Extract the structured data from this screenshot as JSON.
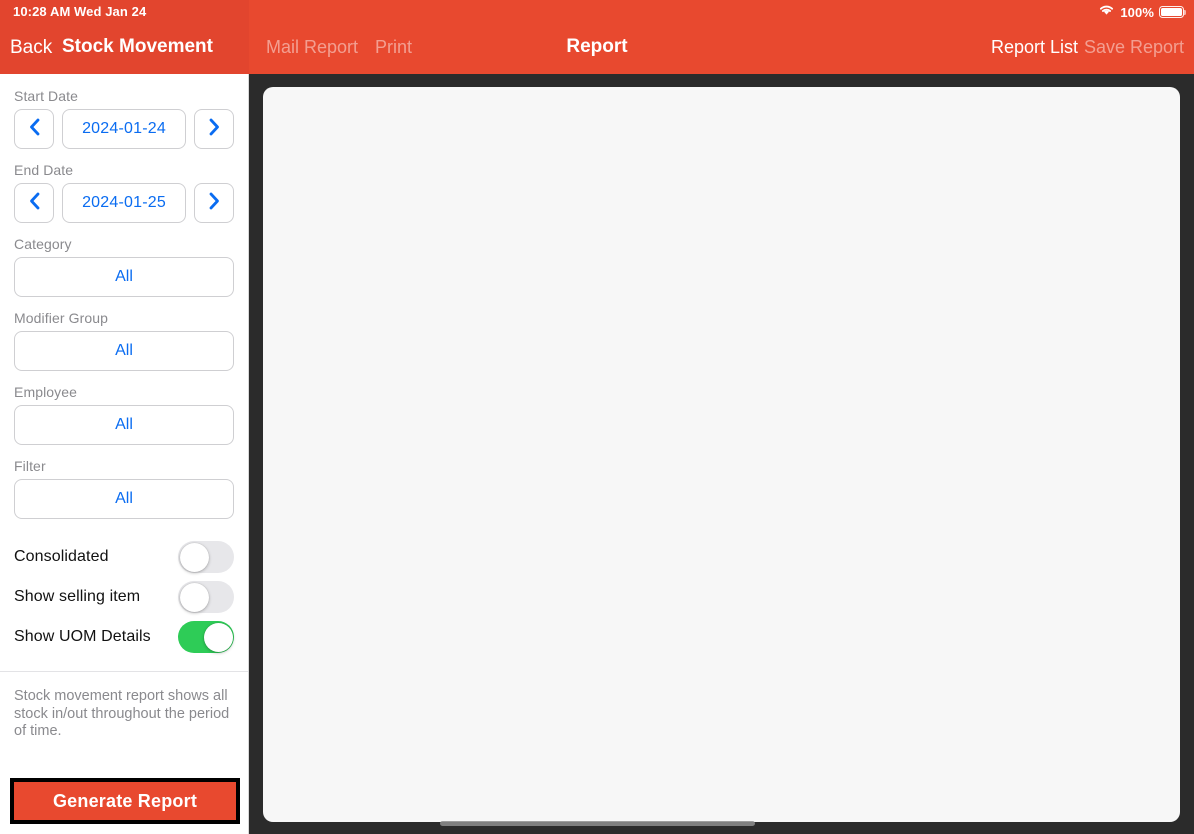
{
  "statusbar": {
    "time": "10:28 AM",
    "date": "Wed Jan 24",
    "battery_percent": "100%",
    "wifi_icon": "wifi-icon",
    "battery_icon": "battery-full-icon"
  },
  "navbar": {
    "back_label": "Back",
    "screen_title": "Stock Movement",
    "mail_report_label": "Mail Report",
    "print_label": "Print",
    "center_title": "Report",
    "report_list_label": "Report List",
    "save_report_label": "Save Report"
  },
  "sidebar": {
    "start_date": {
      "label": "Start Date",
      "value": "2024-01-24",
      "prev_icon": "chevron-left-icon",
      "next_icon": "chevron-right-icon"
    },
    "end_date": {
      "label": "End Date",
      "value": "2024-01-25",
      "prev_icon": "chevron-left-icon",
      "next_icon": "chevron-right-icon"
    },
    "category": {
      "label": "Category",
      "value": "All"
    },
    "modifier_group": {
      "label": "Modifier Group",
      "value": "All"
    },
    "employee": {
      "label": "Employee",
      "value": "All"
    },
    "filter": {
      "label": "Filter",
      "value": "All"
    },
    "toggles": [
      {
        "label": "Consolidated",
        "on": false
      },
      {
        "label": "Show selling item",
        "on": false
      },
      {
        "label": "Show UOM Details",
        "on": true
      }
    ],
    "help_text": "Stock movement report shows all stock in/out throughout the period of time.",
    "generate_button_label": "Generate Report"
  },
  "colors": {
    "brand_red": "#e8492f",
    "sidebar_red": "#e2452e",
    "accent_blue": "#0a6cf1",
    "toggle_on_green": "#2ecc57",
    "canvas_bg": "#f7f7f7",
    "shell_dark": "#2b2b2b"
  }
}
